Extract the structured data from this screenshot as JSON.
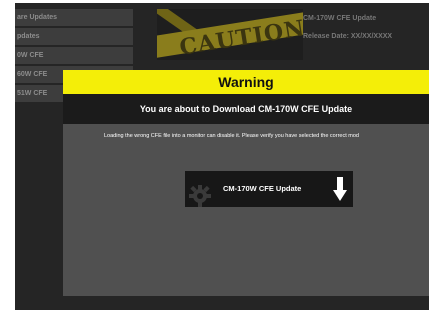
{
  "background": {
    "sidebar_items": [
      {
        "label": "are Updates"
      },
      {
        "label": "pdates"
      },
      {
        "label": "0W CFE"
      },
      {
        "label": "60W CFE"
      },
      {
        "label": "51W CFE"
      }
    ],
    "caution_text": "CAUTION",
    "product_title": "CM-170W CFE Update",
    "release_date": "Release Date: XX/XX/XXXX"
  },
  "modal": {
    "title": "Warning",
    "subtitle": "You are about to Download CM-170W CFE Update",
    "message": "Loading the wrong CFE file into a monitor can disable it. Please verify you have selected the correct mod",
    "download_button_label": "CM-170W CFE Update"
  },
  "colors": {
    "warning_yellow": "#f4ee08",
    "modal_gray": "#505050",
    "button_black": "#171717"
  },
  "icons": {
    "download": "download-arrow-icon",
    "gear": "gear-icon"
  }
}
